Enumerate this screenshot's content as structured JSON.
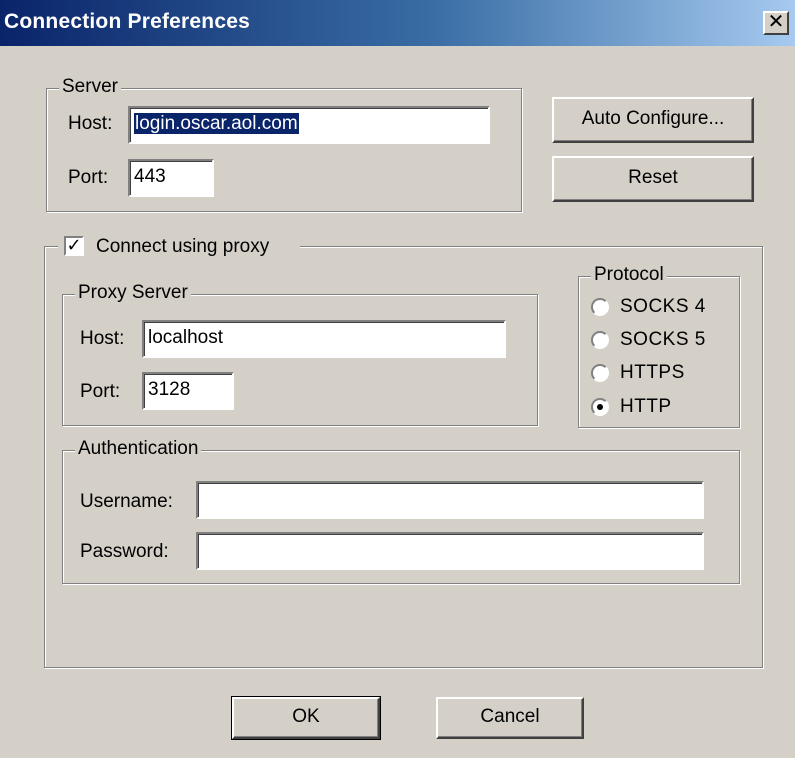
{
  "window": {
    "title": "Connection Preferences",
    "close_glyph": "✕"
  },
  "server": {
    "legend": "Server",
    "host_label": "Host:",
    "host_value": "login.oscar.aol.com",
    "port_label": "Port:",
    "port_value": "443"
  },
  "buttons": {
    "auto_configure": "Auto Configure...",
    "reset": "Reset",
    "ok": "OK",
    "cancel": "Cancel"
  },
  "proxy": {
    "checkbox_label": "Connect using proxy",
    "checked": true,
    "server_legend": "Proxy Server",
    "host_label": "Host:",
    "host_value": "localhost",
    "port_label": "Port:",
    "port_value": "3128"
  },
  "protocol": {
    "legend": "Protocol",
    "options": [
      "SOCKS 4",
      "SOCKS 5",
      "HTTPS",
      "HTTP"
    ],
    "selected": "HTTP"
  },
  "auth": {
    "legend": "Authentication",
    "username_label": "Username:",
    "username_value": "",
    "password_label": "Password:",
    "password_value": ""
  },
  "colors": {
    "face": "#d4d0c8",
    "title_start": "#0a246a",
    "title_end": "#a6caf0",
    "selection": "#0a246a"
  }
}
